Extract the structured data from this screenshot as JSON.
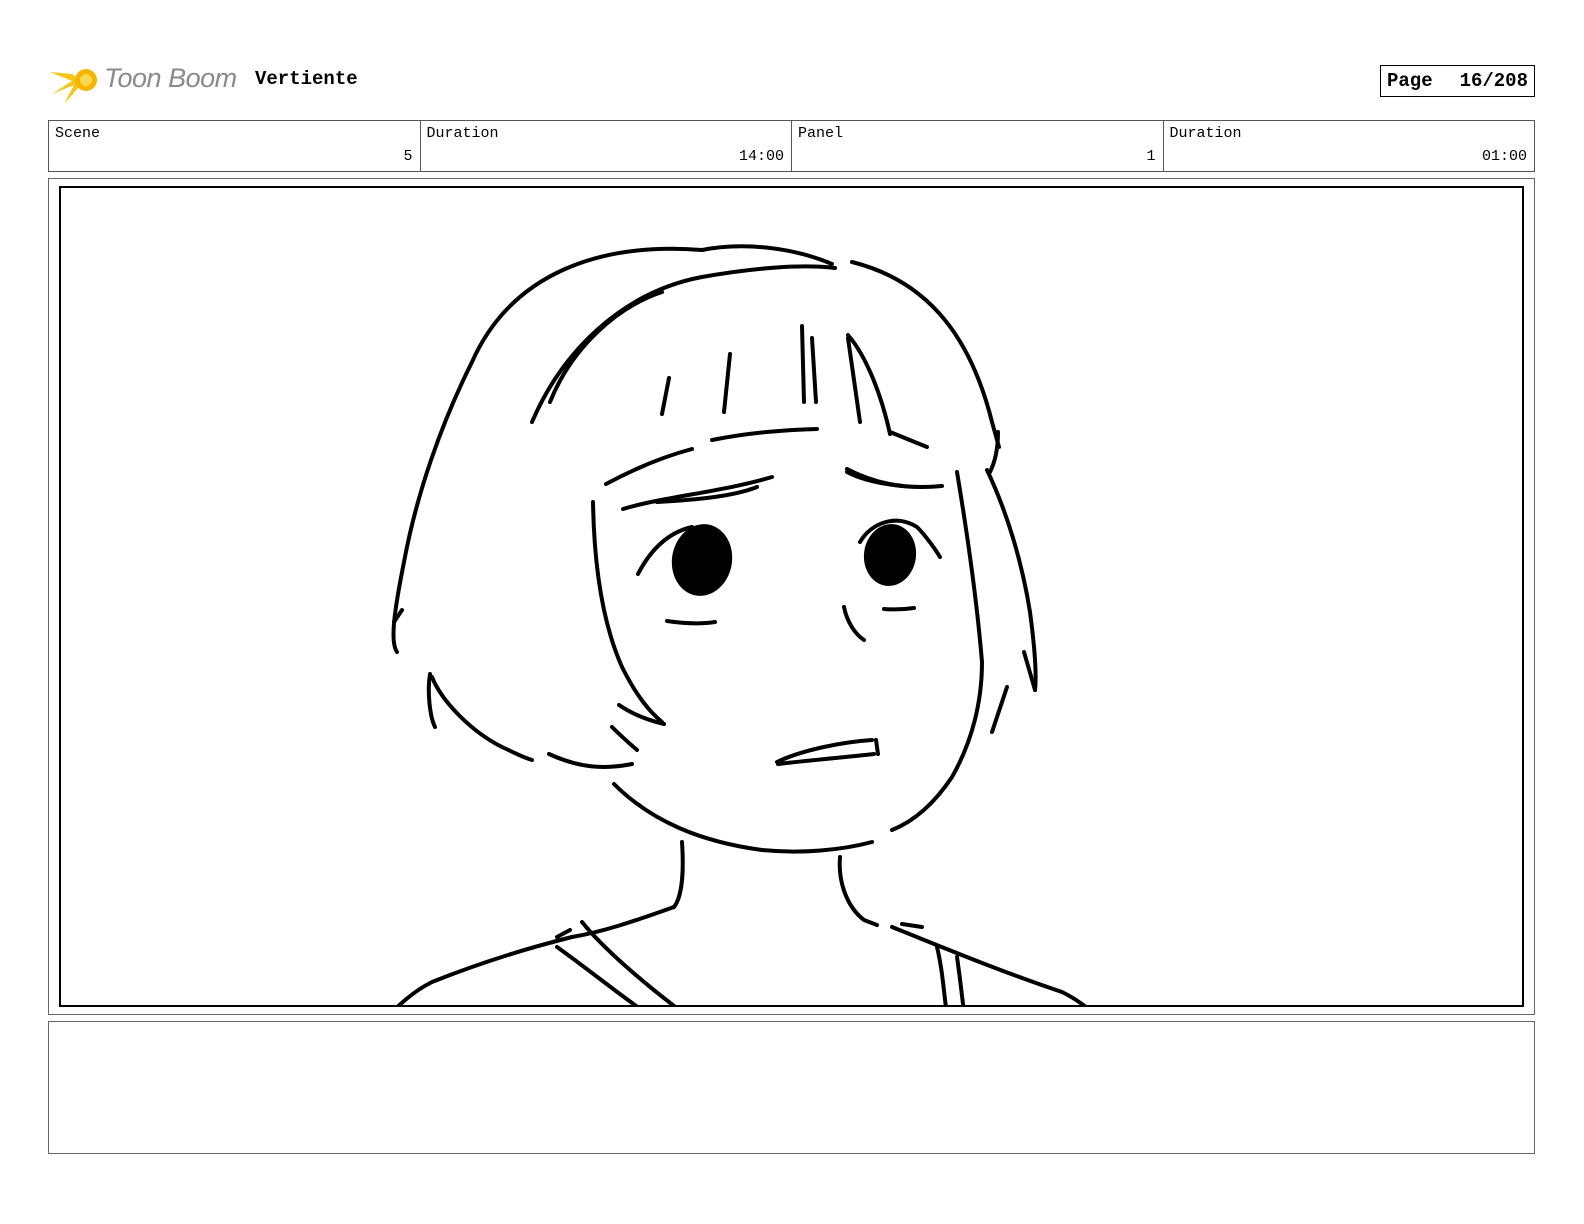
{
  "header": {
    "logo_text": "Toon Boom",
    "project_title": "Vertiente",
    "page_label": "Page",
    "page_number": "16/208"
  },
  "info": {
    "scene_label": "Scene",
    "scene_value": "5",
    "scene_duration_label": "Duration",
    "scene_duration_value": "14:00",
    "panel_label": "Panel",
    "panel_value": "1",
    "panel_duration_label": "Duration",
    "panel_duration_value": "01:00"
  },
  "colors": {
    "logo_accent": "#f5c518",
    "logo_text": "#8a8a8a"
  }
}
